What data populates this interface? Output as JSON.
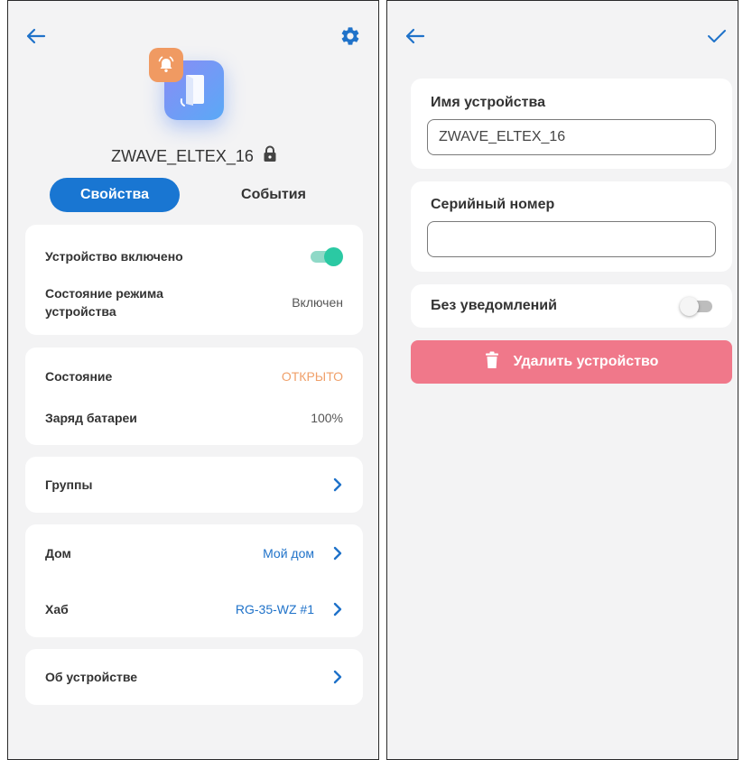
{
  "left": {
    "header": {
      "back_icon": "arrow-left-icon",
      "settings_icon": "gear-icon"
    },
    "device": {
      "name": "ZWAVE_ELTEX_16",
      "icon": "door-sensor-icon",
      "alarm_icon": "bell-alarm-icon",
      "lock_icon": "lock-icon"
    },
    "tabs": [
      {
        "label": "Свойства",
        "active": true
      },
      {
        "label": "События",
        "active": false
      }
    ],
    "status_card": {
      "enabled_label": "Устройство включено",
      "enabled": true,
      "mode_label": "Состояние режима устройства",
      "mode_value": "Включен"
    },
    "state_card": {
      "state_label": "Состояние",
      "state_value": "ОТКРЫТО",
      "battery_label": "Заряд батареи",
      "battery_value": "100%"
    },
    "groups_card": {
      "label": "Группы"
    },
    "location_card": {
      "home_label": "Дом",
      "home_value": "Мой дом",
      "hub_label": "Хаб",
      "hub_value": "RG-35-WZ #1"
    },
    "about_card": {
      "label": "Об устройстве"
    }
  },
  "right": {
    "header": {
      "back_icon": "arrow-left-icon",
      "confirm_icon": "check-icon"
    },
    "name_field": {
      "label": "Имя устройства",
      "value": "ZWAVE_ELTEX_16"
    },
    "serial_field": {
      "label": "Серийный номер",
      "value": ""
    },
    "no_notifications": {
      "label": "Без уведомлений",
      "enabled": false
    },
    "delete_button": {
      "label": "Удалить устройство",
      "icon": "trash-icon"
    }
  },
  "colors": {
    "accent": "#1976d2",
    "link": "#1f72c9",
    "state_open": "#f0a06a",
    "toggle_on": "#2bc9a3",
    "delete": "#f0788a",
    "alarm_badge": "#f09a62"
  }
}
